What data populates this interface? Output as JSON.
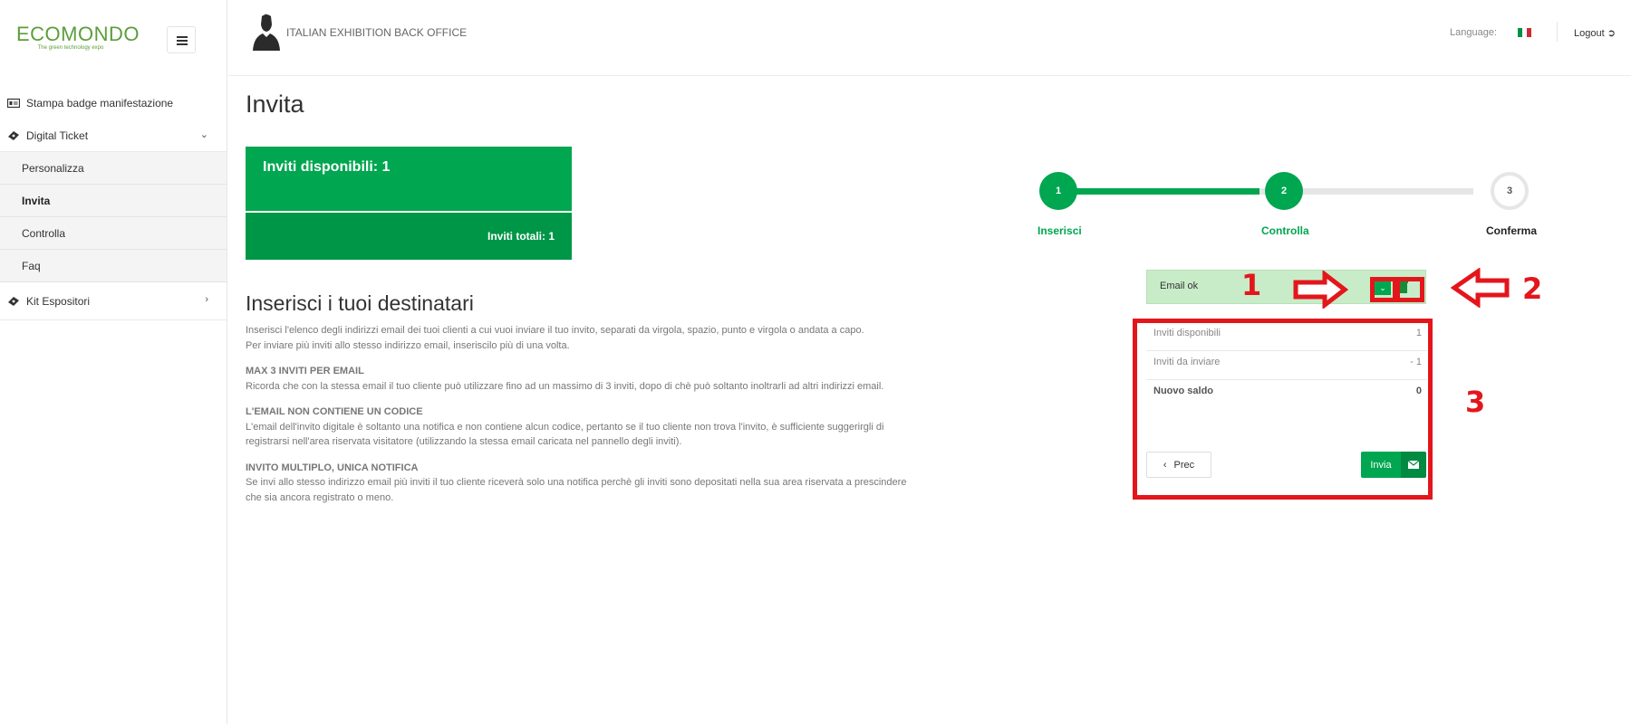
{
  "brand": {
    "logo_main": "ECOMONDO",
    "logo_sub": "The green technology expo"
  },
  "sidebar": {
    "items": [
      {
        "label": "Stampa badge manifestazione",
        "icon": "badge-icon"
      },
      {
        "label": "Digital Ticket",
        "icon": "ticket-icon",
        "expanded": true,
        "children": [
          {
            "label": "Personalizza"
          },
          {
            "label": "Invita",
            "active": true
          },
          {
            "label": "Controlla"
          },
          {
            "label": "Faq"
          }
        ]
      },
      {
        "label": "Kit Espositori",
        "icon": "ticket-icon",
        "expanded": false
      }
    ]
  },
  "header": {
    "title": "ITALIAN EXHIBITION BACK OFFICE",
    "language_label": "Language:",
    "logout_label": "Logout"
  },
  "main": {
    "page_title": "Invita",
    "invites_available": "Inviti disponibili: 1",
    "invites_total": "Inviti totali: 1",
    "section_title": "Inserisci i tuoi destinatari",
    "intro_1": "Inserisci l'elenco degli indirizzi email dei tuoi clienti a cui vuoi inviare il tuo invito, separati da virgola, spazio, punto e virgola o andata a capo.",
    "intro_2": "Per inviare più inviti allo stesso indirizzo email, inseriscilo più di una volta.",
    "notes": [
      {
        "title": "MAX 3 INVITI PER EMAIL",
        "text": "Ricorda che con la stessa email il tuo cliente può utilizzare fino ad un massimo di 3 inviti, dopo di chè può soltanto inoltrarli ad altri indirizzi email."
      },
      {
        "title": "L'EMAIL NON CONTIENE UN CODICE",
        "text": "L'email dell'invito digitale è soltanto una notifica e non contiene alcun codice, pertanto se il tuo cliente non trova l'invito, è sufficiente suggerirgli di registrarsi nell'area riservata visitatore (utilizzando la stessa email caricata nel pannello degli inviti)."
      },
      {
        "title": "INVITO MULTIPLO, UNICA NOTIFICA",
        "text": "Se invi allo stesso indirizzo email più inviti il tuo cliente riceverà solo una notifica perchè gli inviti sono depositati nella sua area riservata a prescindere che sia ancora registrato o meno."
      }
    ]
  },
  "stepper": {
    "steps": [
      {
        "num": "1",
        "label": "Inserisci",
        "state": "done"
      },
      {
        "num": "2",
        "label": "Controlla",
        "state": "current"
      },
      {
        "num": "3",
        "label": "Conferma",
        "state": "todo"
      }
    ]
  },
  "check": {
    "email_status": "Email ok",
    "summary": [
      {
        "label": "Inviti disponibili",
        "value": "1"
      },
      {
        "label": "Inviti da inviare",
        "value": "- 1"
      },
      {
        "label": "Nuovo saldo",
        "value": "0"
      }
    ],
    "prev_label": "Prec",
    "send_label": "Invia"
  },
  "annotations": [
    "1",
    "2",
    "3"
  ],
  "colors": {
    "accent": "#00a650",
    "accent_dark": "#009647",
    "annotation": "#e3161c",
    "email_ok_bg": "#c8ecc8"
  }
}
